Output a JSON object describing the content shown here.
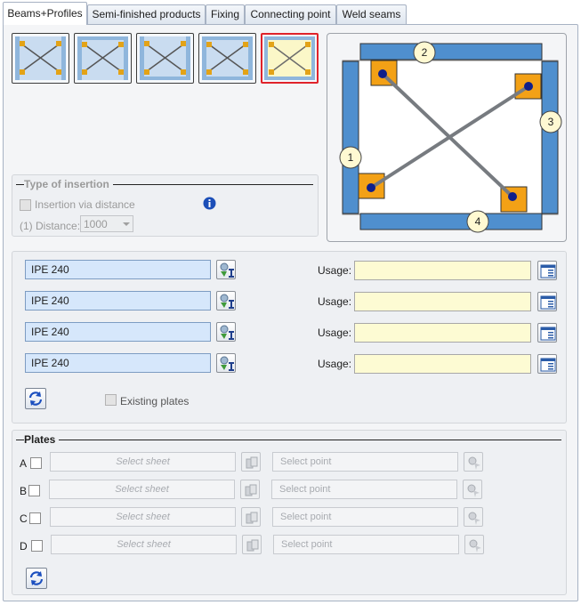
{
  "tabs": [
    {
      "label": "Beams+Profiles",
      "active": true
    },
    {
      "label": "Semi-finished products",
      "active": false
    },
    {
      "label": "Fixing",
      "active": false
    },
    {
      "label": "Connecting point",
      "active": false
    },
    {
      "label": "Weld seams",
      "active": false
    }
  ],
  "preview": {
    "callouts": [
      "1",
      "2",
      "3",
      "4"
    ]
  },
  "insertion": {
    "title": "Type of insertion",
    "via_distance_label": "Insertion via distance",
    "distance_label": "(1) Distance:",
    "distance_value": "1000"
  },
  "profiles": {
    "usage_label": "Usage:",
    "rows": [
      {
        "profile": "IPE 240",
        "usage": ""
      },
      {
        "profile": "IPE 240",
        "usage": ""
      },
      {
        "profile": "IPE 240",
        "usage": ""
      },
      {
        "profile": "IPE 240",
        "usage": ""
      }
    ],
    "existing_plates_label": "Existing plates"
  },
  "plates": {
    "title": "Plates",
    "sheet_placeholder": "Select sheet",
    "point_placeholder": "Select point",
    "rows": [
      {
        "letter": "A"
      },
      {
        "letter": "B"
      },
      {
        "letter": "C"
      },
      {
        "letter": "D"
      }
    ]
  },
  "colors": {
    "beam_blue": "#4f8fce",
    "plate_orange": "#f3a116",
    "selected_border": "#e0232a",
    "profile_field": "#d6e7fb",
    "usage_field": "#fdfbd3"
  },
  "icons": {
    "info": "info-icon",
    "profile_select": "profile-catalog-icon",
    "usage_select": "usage-list-icon",
    "refresh": "refresh-icon",
    "sheet_select": "sheet-catalog-icon",
    "point_select": "point-pick-icon"
  }
}
